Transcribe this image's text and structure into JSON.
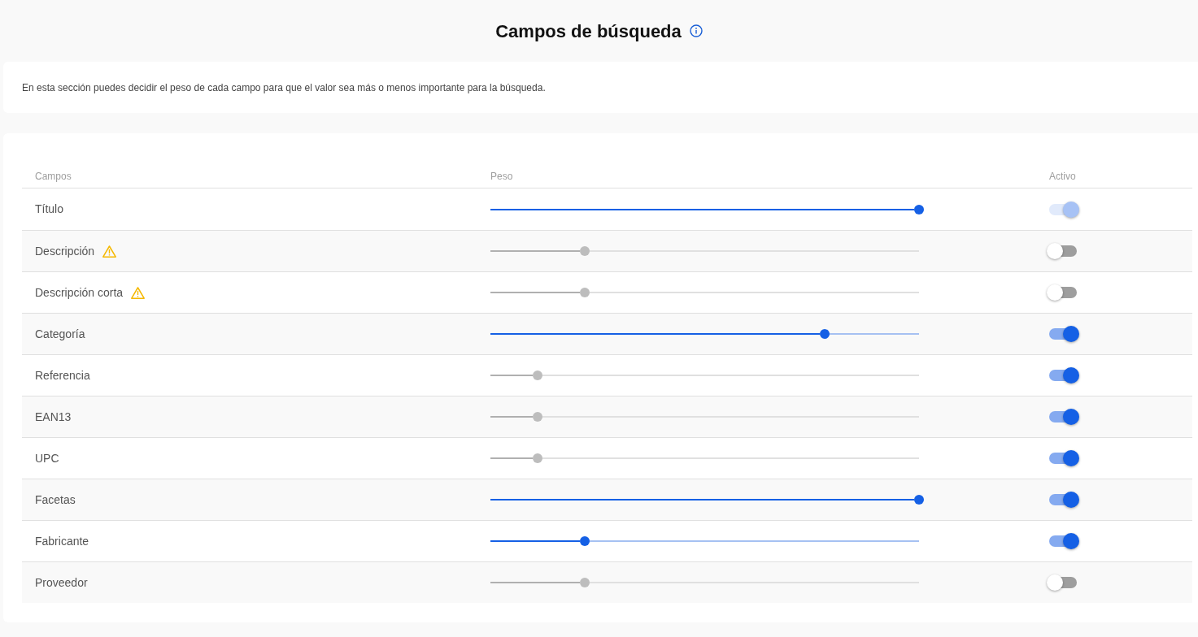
{
  "header": {
    "title": "Campos de búsqueda"
  },
  "intro": {
    "text": "En esta sección puedes decidir el peso de cada campo para que el valor sea más o menos importante para la búsqueda."
  },
  "table": {
    "columns": [
      "Campos",
      "Peso",
      "Activo"
    ],
    "rows": [
      {
        "field": "Título",
        "warning": false,
        "weight": {
          "level": 1,
          "disabled": false
        },
        "active": {
          "on": true,
          "disabled": true
        }
      },
      {
        "field": "Descripción",
        "warning": true,
        "weight": {
          "level": 0.22,
          "disabled": true
        },
        "active": {
          "on": false,
          "disabled": false
        }
      },
      {
        "field": "Descripción corta",
        "warning": true,
        "weight": {
          "level": 0.22,
          "disabled": true
        },
        "active": {
          "on": false,
          "disabled": false
        }
      },
      {
        "field": "Categoría",
        "warning": false,
        "weight": {
          "level": 0.78,
          "disabled": false
        },
        "active": {
          "on": true,
          "disabled": false
        }
      },
      {
        "field": "Referencia",
        "warning": false,
        "weight": {
          "level": 0.11,
          "disabled": true
        },
        "active": {
          "on": true,
          "disabled": false
        }
      },
      {
        "field": "EAN13",
        "warning": false,
        "weight": {
          "level": 0.11,
          "disabled": true
        },
        "active": {
          "on": true,
          "disabled": false
        }
      },
      {
        "field": "UPC",
        "warning": false,
        "weight": {
          "level": 0.11,
          "disabled": true
        },
        "active": {
          "on": true,
          "disabled": false
        }
      },
      {
        "field": "Facetas",
        "warning": false,
        "weight": {
          "level": 1,
          "disabled": false
        },
        "active": {
          "on": true,
          "disabled": false
        }
      },
      {
        "field": "Fabricante",
        "warning": false,
        "weight": {
          "level": 0.22,
          "disabled": false
        },
        "active": {
          "on": true,
          "disabled": false
        }
      },
      {
        "field": "Proveedor",
        "warning": false,
        "weight": {
          "level": 0.22,
          "disabled": true
        },
        "active": {
          "on": false,
          "disabled": false
        }
      }
    ]
  }
}
